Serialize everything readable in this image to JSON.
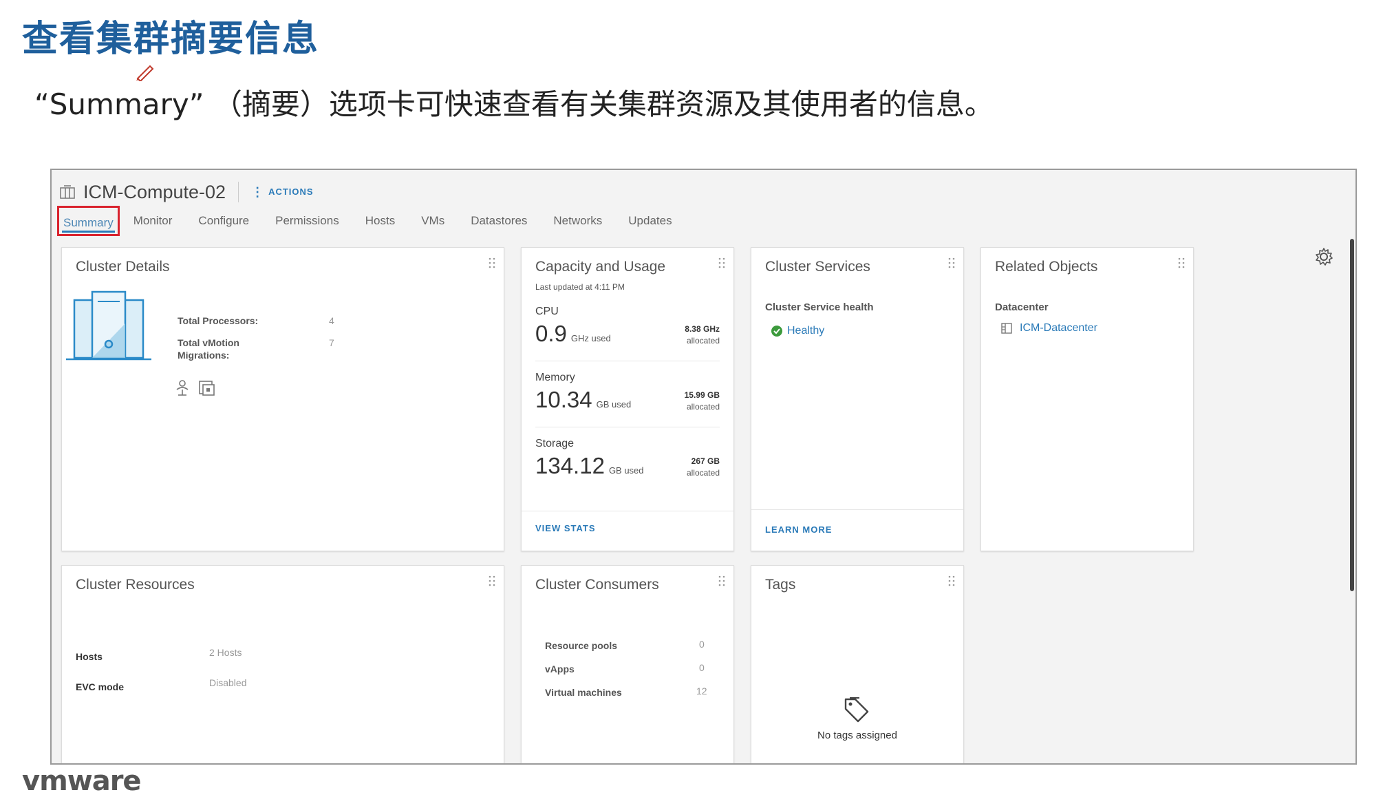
{
  "slide": {
    "title": "查看集群摘要信息",
    "subtitle": "“Summary” （摘要）选项卡可快速查看有关集群资源及其使用者的信息。"
  },
  "header": {
    "object_name": "ICM-Compute-02",
    "actions_label": "ACTIONS",
    "tabs": [
      {
        "label": "Summary",
        "active": true
      },
      {
        "label": "Monitor"
      },
      {
        "label": "Configure"
      },
      {
        "label": "Permissions"
      },
      {
        "label": "Hosts"
      },
      {
        "label": "VMs"
      },
      {
        "label": "Datastores"
      },
      {
        "label": "Networks"
      },
      {
        "label": "Updates"
      }
    ]
  },
  "cluster_details": {
    "title": "Cluster Details",
    "total_processors_label": "Total Processors:",
    "total_processors_value": "4",
    "total_vmotion_label": "Total vMotion",
    "total_vmotion_label2": "Migrations:",
    "total_vmotion_value": "7"
  },
  "capacity": {
    "title": "Capacity and Usage",
    "last_updated": "Last updated at 4:11 PM",
    "cpu": {
      "label": "CPU",
      "used": "0.9",
      "used_unit": "GHz used",
      "allocated": "8.38 GHz",
      "allocated_label": "allocated"
    },
    "memory": {
      "label": "Memory",
      "used": "10.34",
      "used_unit": "GB used",
      "allocated": "15.99 GB",
      "allocated_label": "allocated"
    },
    "storage": {
      "label": "Storage",
      "used": "134.12",
      "used_unit": "GB used",
      "allocated": "267 GB",
      "allocated_label": "allocated"
    },
    "view_stats": "VIEW STATS"
  },
  "cluster_services": {
    "title": "Cluster Services",
    "health_label": "Cluster Service health",
    "health_value": "Healthy",
    "learn_more": "LEARN MORE"
  },
  "related_objects": {
    "title": "Related Objects",
    "datacenter_label": "Datacenter",
    "datacenter_value": "ICM-Datacenter"
  },
  "cluster_resources": {
    "title": "Cluster Resources",
    "hosts_label": "Hosts",
    "hosts_value": "2 Hosts",
    "evc_label": "EVC mode",
    "evc_value": "Disabled"
  },
  "cluster_consumers": {
    "title": "Cluster Consumers",
    "rows": [
      {
        "label": "Resource pools",
        "value": "0"
      },
      {
        "label": "vApps",
        "value": "0"
      },
      {
        "label": "Virtual machines",
        "value": "12"
      }
    ]
  },
  "tags": {
    "title": "Tags",
    "empty_text": "No tags assigned"
  },
  "footer": {
    "logo": "vmware"
  },
  "colors": {
    "accent": "#2a7ab8",
    "title_blue": "#1f5f9c",
    "highlight_red": "#d9232e",
    "healthy_green": "#3c9a3c"
  }
}
